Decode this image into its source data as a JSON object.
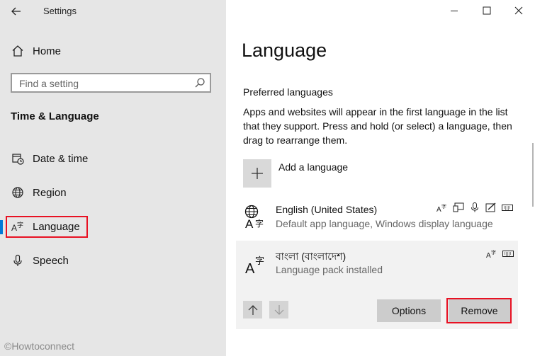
{
  "window": {
    "title": "Settings",
    "controls": [
      "minimize",
      "maximize",
      "close"
    ]
  },
  "sidebar": {
    "home_label": "Home",
    "search_placeholder": "Find a setting",
    "section_heading": "Time & Language",
    "items": [
      {
        "label": "Date & time",
        "icon": "calendar-clock-icon"
      },
      {
        "label": "Region",
        "icon": "globe-icon"
      },
      {
        "label": "Language",
        "icon": "language-icon",
        "active": true
      },
      {
        "label": "Speech",
        "icon": "microphone-icon"
      }
    ]
  },
  "main": {
    "title": "Language",
    "preferred_heading": "Preferred languages",
    "description": "Apps and websites will appear in the first language in the list that they support. Press and hold (or select) a language, then drag to rearrange them.",
    "add_language_label": "Add a language",
    "languages": [
      {
        "name": "English (United States)",
        "status": "Default app language, Windows display language",
        "features": [
          "language-pack-icon",
          "text-to-speech-icon",
          "speech-recognition-icon",
          "handwriting-icon",
          "keyboard-icon"
        ]
      },
      {
        "name": "বাংলা (বাংলাদেশ)",
        "status": "Language pack installed",
        "features": [
          "language-pack-icon",
          "keyboard-icon"
        ],
        "selected": true
      }
    ],
    "options_label": "Options",
    "remove_label": "Remove"
  },
  "watermark": "©Howtoconnect",
  "accent_color": "#0078d7",
  "highlight_color": "#e81123"
}
